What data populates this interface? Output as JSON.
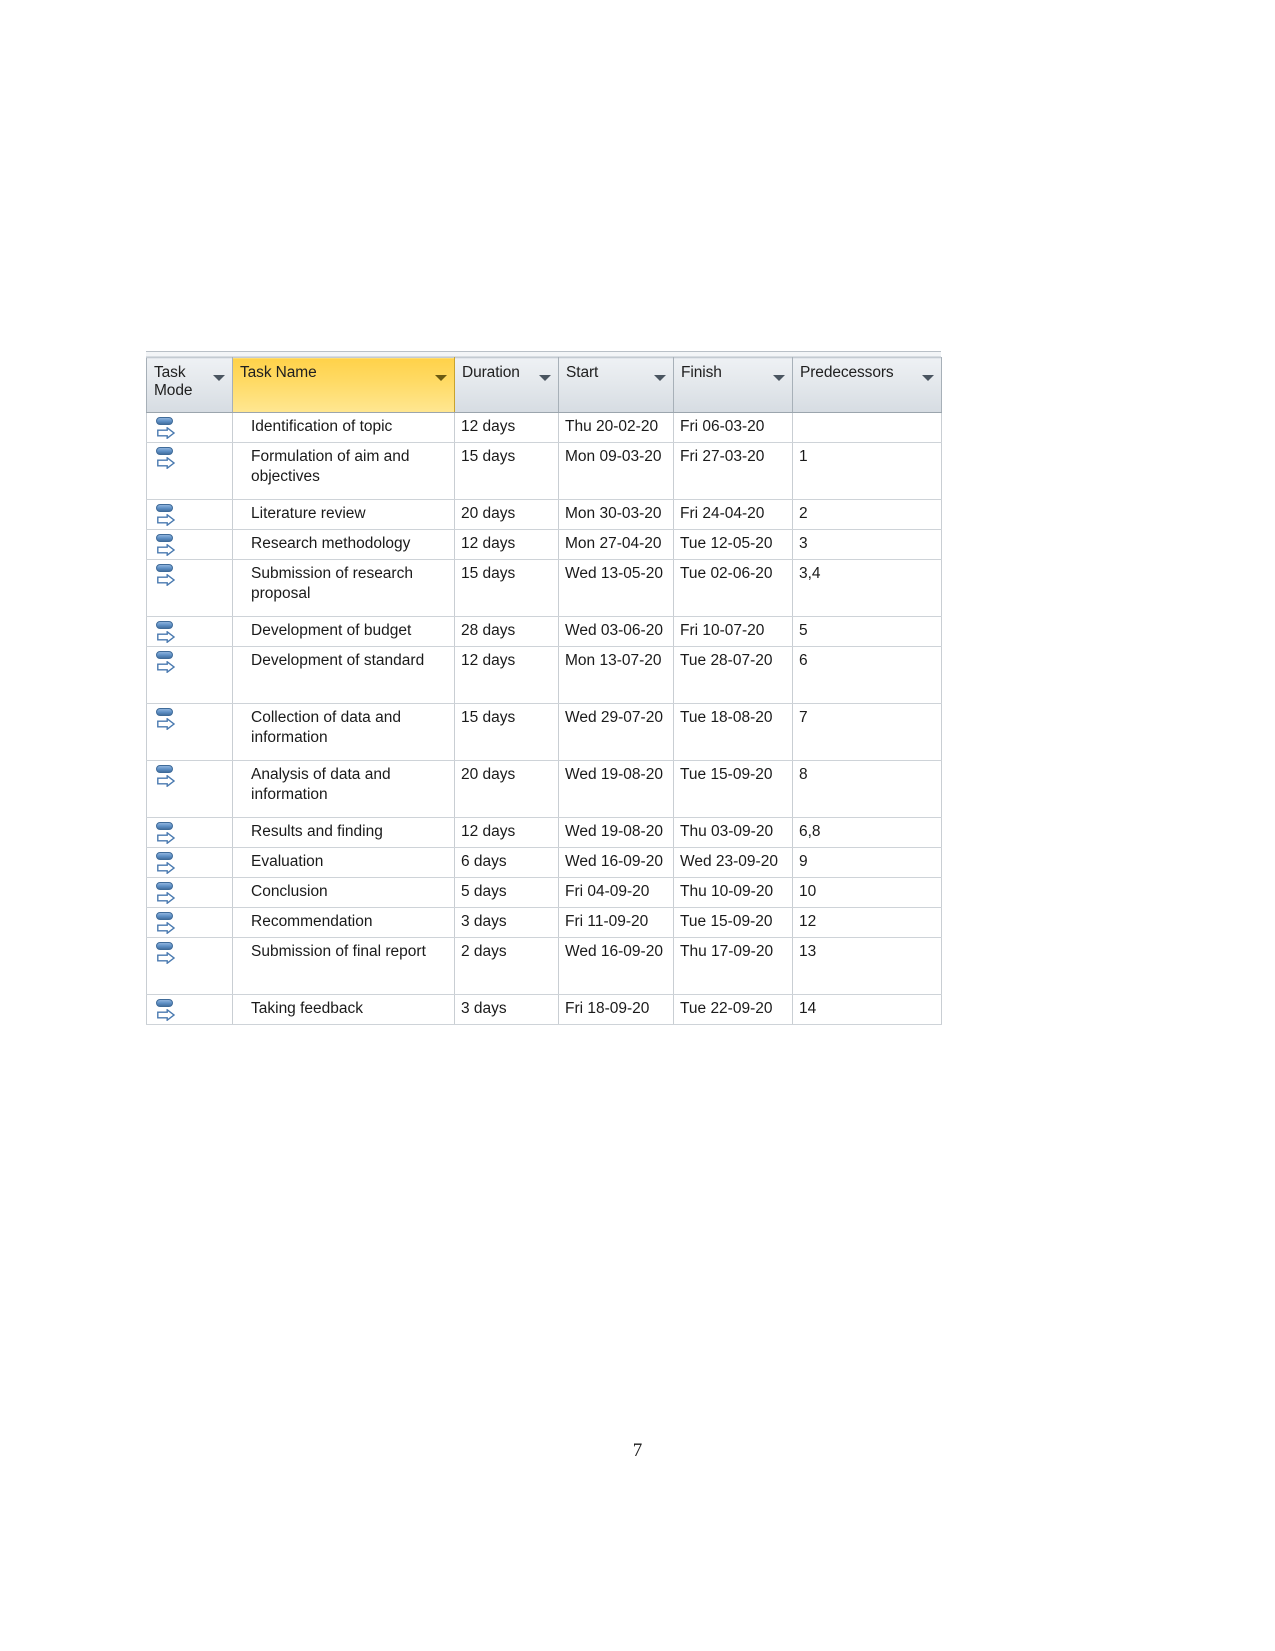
{
  "document": {
    "page_number": "7"
  },
  "table": {
    "columns": [
      {
        "key": "task_mode",
        "label": "Task\nMode",
        "icon": "filter-dropdown-icon",
        "highlighted": false
      },
      {
        "key": "task_name",
        "label": "Task Name",
        "icon": "filter-dropdown-icon",
        "highlighted": true
      },
      {
        "key": "duration",
        "label": "Duration",
        "icon": "filter-dropdown-icon",
        "highlighted": false
      },
      {
        "key": "start",
        "label": "Start",
        "icon": "filter-dropdown-icon",
        "highlighted": false
      },
      {
        "key": "finish",
        "label": "Finish",
        "icon": "filter-dropdown-icon",
        "highlighted": false
      },
      {
        "key": "predecessors",
        "label": "Predecessors",
        "icon": "filter-dropdown-icon",
        "highlighted": false
      }
    ],
    "row_icon_name": "manually-scheduled-task-icon",
    "rows": [
      {
        "task_mode": "manually-scheduled-task-icon",
        "task_name": "Identification of topic",
        "duration": "12 days",
        "start": "Thu 20-02-20",
        "finish": "Fri 06-03-20",
        "predecessors": "",
        "tall": false
      },
      {
        "task_mode": "manually-scheduled-task-icon",
        "task_name": "Formulation of aim and objectives",
        "duration": "15 days",
        "start": "Mon 09-03-20",
        "finish": "Fri 27-03-20",
        "predecessors": "1",
        "tall": true
      },
      {
        "task_mode": "manually-scheduled-task-icon",
        "task_name": "Literature review",
        "duration": "20 days",
        "start": "Mon 30-03-20",
        "finish": "Fri 24-04-20",
        "predecessors": "2",
        "tall": false
      },
      {
        "task_mode": "manually-scheduled-task-icon",
        "task_name": "Research methodology",
        "duration": "12 days",
        "start": "Mon 27-04-20",
        "finish": "Tue 12-05-20",
        "predecessors": "3",
        "tall": false
      },
      {
        "task_mode": "manually-scheduled-task-icon",
        "task_name": "Submission of research proposal",
        "duration": "15 days",
        "start": "Wed 13-05-20",
        "finish": "Tue 02-06-20",
        "predecessors": "3,4",
        "tall": true
      },
      {
        "task_mode": "manually-scheduled-task-icon",
        "task_name": "Development of budget",
        "duration": "28 days",
        "start": "Wed 03-06-20",
        "finish": "Fri 10-07-20",
        "predecessors": "5",
        "tall": false
      },
      {
        "task_mode": "manually-scheduled-task-icon",
        "task_name": "Development of standard",
        "duration": "12 days",
        "start": "Mon 13-07-20",
        "finish": "Tue 28-07-20",
        "predecessors": "6",
        "tall": true
      },
      {
        "task_mode": "manually-scheduled-task-icon",
        "task_name": "Collection of data and information",
        "duration": "15 days",
        "start": "Wed 29-07-20",
        "finish": "Tue 18-08-20",
        "predecessors": "7",
        "tall": true
      },
      {
        "task_mode": "manually-scheduled-task-icon",
        "task_name": "Analysis of data and information",
        "duration": "20 days",
        "start": "Wed 19-08-20",
        "finish": "Tue 15-09-20",
        "predecessors": "8",
        "tall": true
      },
      {
        "task_mode": "manually-scheduled-task-icon",
        "task_name": "Results and finding",
        "duration": "12 days",
        "start": "Wed 19-08-20",
        "finish": "Thu 03-09-20",
        "predecessors": "6,8",
        "tall": false
      },
      {
        "task_mode": "manually-scheduled-task-icon",
        "task_name": "Evaluation",
        "duration": "6 days",
        "start": "Wed 16-09-20",
        "finish": "Wed 23-09-20",
        "predecessors": "9",
        "tall": false
      },
      {
        "task_mode": "manually-scheduled-task-icon",
        "task_name": "Conclusion",
        "duration": "5 days",
        "start": "Fri 04-09-20",
        "finish": "Thu 10-09-20",
        "predecessors": "10",
        "tall": false
      },
      {
        "task_mode": "manually-scheduled-task-icon",
        "task_name": "Recommendation",
        "duration": "3 days",
        "start": "Fri 11-09-20",
        "finish": "Tue 15-09-20",
        "predecessors": "12",
        "tall": false
      },
      {
        "task_mode": "manually-scheduled-task-icon",
        "task_name": "Submission of final report",
        "duration": "2 days",
        "start": "Wed 16-09-20",
        "finish": "Thu 17-09-20",
        "predecessors": "13",
        "tall": true
      },
      {
        "task_mode": "manually-scheduled-task-icon",
        "task_name": "Taking feedback",
        "duration": "3 days",
        "start": "Fri 18-09-20",
        "finish": "Tue 22-09-20",
        "predecessors": "14",
        "tall": false
      }
    ]
  },
  "colors": {
    "header_gray": "#e4e8ec",
    "header_highlight_yellow": "#ffda63",
    "grid_line": "#c9ced3",
    "task_icon_blue": "#5d8ec4"
  }
}
